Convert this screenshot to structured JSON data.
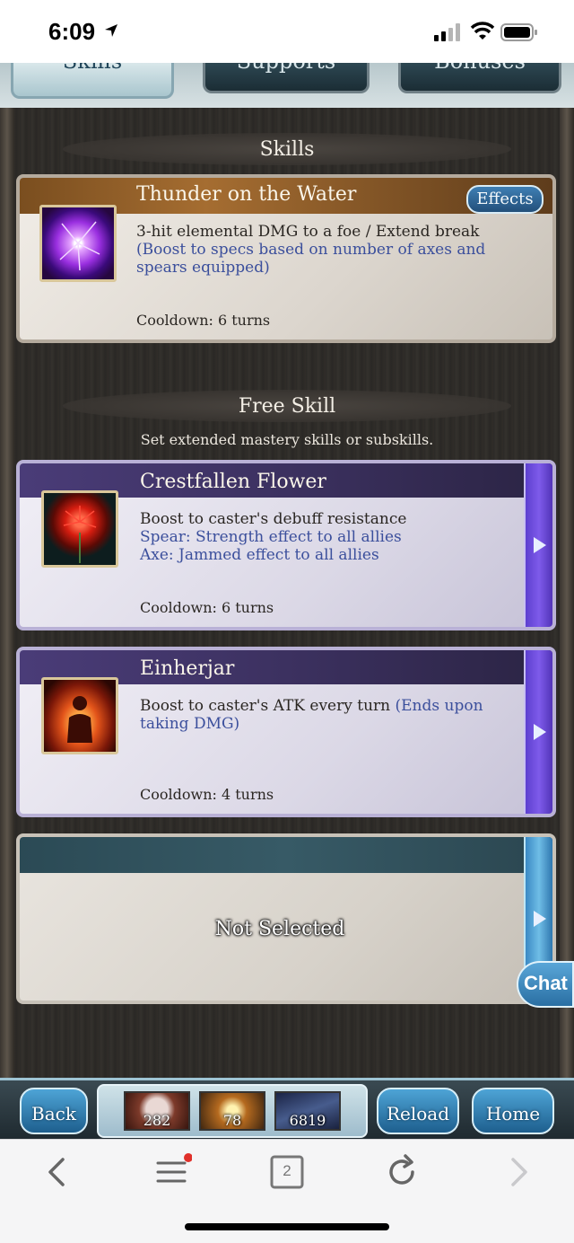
{
  "status_bar": {
    "time": "6:09"
  },
  "tabs": [
    {
      "label": "Skills"
    },
    {
      "label": "Supports"
    },
    {
      "label": "Bonuses"
    }
  ],
  "skills_section": {
    "title": "Skills",
    "skill": {
      "name": "Thunder on the Water",
      "effects_label": "Effects",
      "description": "3-hit elemental DMG to a foe / Extend break",
      "description_blue": "(Boost to specs based on number of axes and spears equipped)",
      "cooldown": "Cooldown: 6 turns"
    }
  },
  "free_skill_section": {
    "title": "Free Skill",
    "subtitle": "Set extended mastery skills or subskills.",
    "skills": [
      {
        "name": "Crestfallen Flower",
        "description": "Boost to caster's debuff resistance",
        "description_blue_1": "Spear: Strength effect to all allies",
        "description_blue_2": "Axe: Jammed effect to all allies",
        "cooldown": "Cooldown: 6 turns"
      },
      {
        "name": "Einherjar",
        "description": "Boost to caster's ATK every turn",
        "description_blue": "(Ends upon taking DMG)",
        "cooldown": "Cooldown: 4 turns"
      }
    ],
    "empty_slot_label": "Not Selected"
  },
  "chat_label": "Chat",
  "game_nav": {
    "back_label": "Back",
    "reload_label": "Reload",
    "home_label": "Home",
    "counters": [
      {
        "value": "282"
      },
      {
        "value": "78"
      },
      {
        "value": "6819"
      }
    ]
  },
  "browser_toolbar": {
    "tabs_count": "2"
  },
  "colors": {
    "accent_blue": "#3b4f9c",
    "skill_bar_brown": "#a56d31",
    "skill_bar_purple": "#4a3c78"
  }
}
